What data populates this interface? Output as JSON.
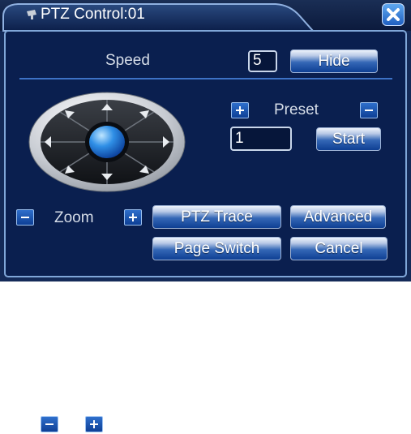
{
  "dialog": {
    "title": "PTZ Control:01",
    "speed_label": "Speed",
    "speed_value": "5",
    "hide_label": "Hide",
    "preset_label": "Preset",
    "preset_value": "1",
    "start_label": "Start",
    "zoom_label": "Zoom",
    "ptz_trace_label": "PTZ Trace",
    "advanced_label": "Advanced",
    "page_switch_label": "Page Switch",
    "cancel_label": "Cancel"
  },
  "colors": {
    "panel_bg": "#0a1f4f",
    "border": "#7fa6d8",
    "button": "#0e3f93"
  },
  "icons": [
    "ptz-camera-icon",
    "close-icon",
    "plus-icon",
    "minus-icon",
    "joystick-icon"
  ]
}
